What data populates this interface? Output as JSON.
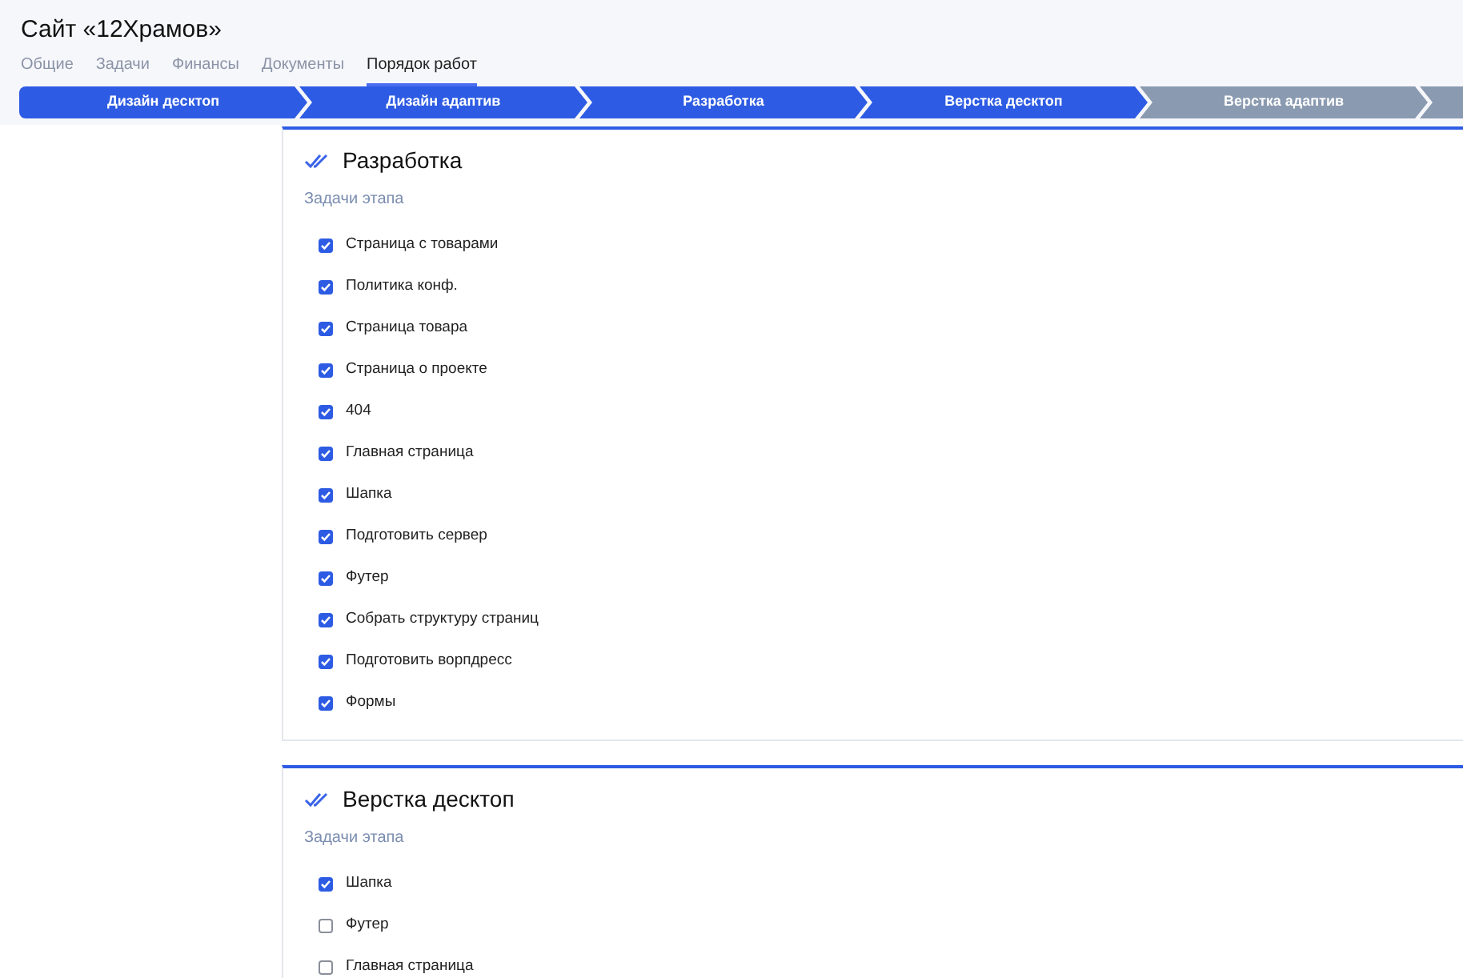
{
  "title": "Сайт «12Храмов»",
  "tabs": [
    {
      "label": "Общие",
      "selected": false
    },
    {
      "label": "Задачи",
      "selected": false
    },
    {
      "label": "Финансы",
      "selected": false
    },
    {
      "label": "Документы",
      "selected": false
    },
    {
      "label": "Порядок работ",
      "selected": true
    }
  ],
  "steps": [
    {
      "label": "Дизайн десктоп",
      "done": true
    },
    {
      "label": "Дизайн адаптив",
      "done": true
    },
    {
      "label": "Разработка",
      "done": true
    },
    {
      "label": "Верстка десктоп",
      "done": true
    },
    {
      "label": "Верстка адаптив",
      "done": false
    },
    {
      "done": false
    }
  ],
  "stages": [
    {
      "title": "Разработка",
      "subtitle": "Задачи этапа",
      "tasks": [
        {
          "label": "Страница с товарами",
          "checked": true
        },
        {
          "label": "Политика конф.",
          "checked": true
        },
        {
          "label": "Страница товара",
          "checked": true
        },
        {
          "label": "Страница о проекте",
          "checked": true
        },
        {
          "label": "404",
          "checked": true
        },
        {
          "label": "Главная страница",
          "checked": true
        },
        {
          "label": "Шапка",
          "checked": true
        },
        {
          "label": "Подготовить сервер",
          "checked": true
        },
        {
          "label": "Футер",
          "checked": true
        },
        {
          "label": "Собрать структуру страниц",
          "checked": true
        },
        {
          "label": "Подготовить ворпдресс",
          "checked": true
        },
        {
          "label": "Формы",
          "checked": true
        }
      ]
    },
    {
      "title": "Верстка десктоп",
      "subtitle": "Задачи этапа",
      "tasks": [
        {
          "label": "Шапка",
          "checked": true
        },
        {
          "label": "Футер",
          "checked": false
        },
        {
          "label": "Главная страница",
          "checked": false
        }
      ]
    }
  ]
}
